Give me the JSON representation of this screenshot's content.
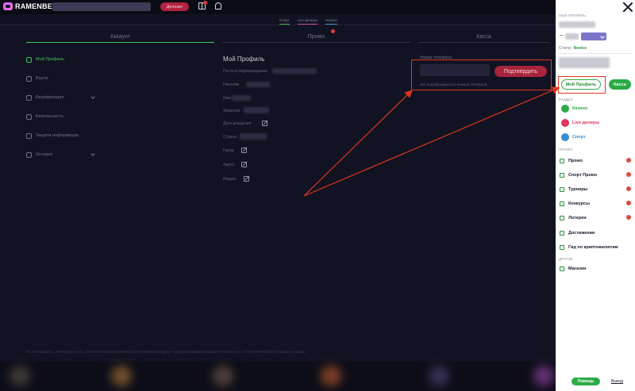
{
  "header": {
    "logo_text": "RAMENBET",
    "deposit_label": "Депозит"
  },
  "subtabs": [
    "Спорт",
    "Live-дилеры",
    "Казино"
  ],
  "tabs": {
    "account": "Аккаунт",
    "promo": "Промо",
    "cashier": "Касса"
  },
  "sidebar": {
    "items": [
      {
        "label": "Мой Профиль",
        "active": true
      },
      {
        "label": "Ваучи"
      },
      {
        "label": "Верификация",
        "expandable": true
      },
      {
        "label": "Безопасность"
      },
      {
        "label": "Защита информации"
      },
      {
        "label": "История",
        "expandable": true
      }
    ]
  },
  "profile": {
    "title": "Мой Профиль",
    "fields": [
      {
        "label": "Почта и подтверждение"
      },
      {
        "label": "Никнейм"
      },
      {
        "label": "Имя"
      },
      {
        "label": "Фамилия"
      },
      {
        "label": "Дата рождения"
      },
      {
        "label": "Страна"
      },
      {
        "label": "Город"
      },
      {
        "label": "Адрес"
      },
      {
        "label": "Индекс"
      }
    ]
  },
  "phone": {
    "label": "Номер телефона",
    "confirm_label": "Подтвердить",
    "note": "Нет подтвержденного номера телефона"
  },
  "footer": {
    "text": "По соглашению с Antillephone N.V., согласно лицензии № 8048/JAZ. Ramenbet находится под управлением компании Prometeus N.V., Grote Kerkstraat 10, Curaçao, Кюрасао."
  },
  "drawer": {
    "section_profile": "МОЙ ПРОФИЛЬ",
    "status_label": "Статус:",
    "status_value": "Novice",
    "my_profile_btn": "Мой Профиль",
    "cashier_btn": "Касса",
    "section_sections": "РАЗДЕЛ",
    "categories": [
      {
        "label": "Казино",
        "color": "#2cab45"
      },
      {
        "label": "Live дилеры",
        "color": "#e0365a"
      },
      {
        "label": "Спорт",
        "color": "#3a8bd6"
      }
    ],
    "section_promo": "ПРОМО",
    "promo_items": [
      {
        "label": "Промо",
        "icon": "eye-icon",
        "badge": true
      },
      {
        "label": "Спорт Промо",
        "icon": "sport-icon",
        "badge": true
      },
      {
        "label": "Турниры",
        "icon": "trophy-icon",
        "badge": true
      },
      {
        "label": "Конкурсы",
        "icon": "contest-icon",
        "badge": true
      },
      {
        "label": "Лотереи",
        "icon": "ticket-icon",
        "badge": true
      },
      {
        "label": "Достижения",
        "icon": "medal-icon",
        "badge": false
      },
      {
        "label": "Гид по криптовалютам",
        "icon": "crypto-icon",
        "badge": false
      }
    ],
    "section_other": "ДРУГОЕ",
    "other_items": [
      {
        "label": "Магазин",
        "icon": "shop-icon"
      }
    ],
    "help_btn": "Помощь",
    "logout_label": "Выход"
  },
  "colors": {
    "accent_green": "#2cab45",
    "accent_red": "#a8243c",
    "annotation_red": "#e0361f"
  }
}
